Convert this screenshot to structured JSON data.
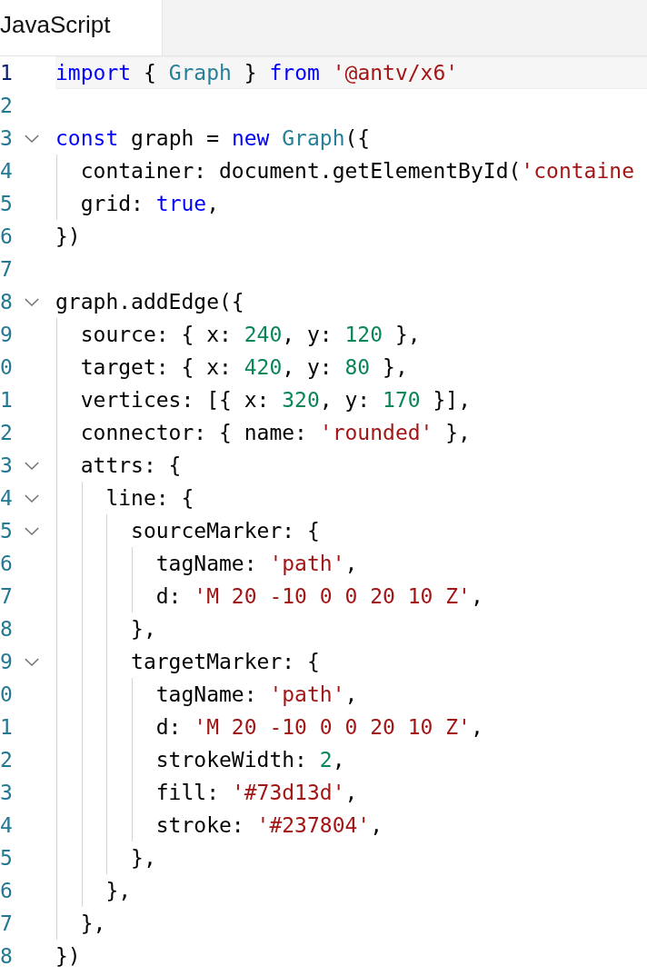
{
  "tabs": [
    {
      "label": "JavaScript",
      "selected": true
    }
  ],
  "lines": [
    {
      "number": "1",
      "current": true,
      "tokens": [
        {
          "kind": "keyword",
          "text": "import"
        },
        {
          "kind": "plain",
          "text": " { "
        },
        {
          "kind": "type",
          "text": "Graph"
        },
        {
          "kind": "plain",
          "text": " } "
        },
        {
          "kind": "keyword",
          "text": "from "
        },
        {
          "kind": "string",
          "text": "'@antv/x6'"
        }
      ]
    },
    {
      "number": "2",
      "current": false
    },
    {
      "number": "3",
      "current": false,
      "fold": {
        "expanded": true
      },
      "tokens": [
        {
          "kind": "keyword",
          "text": "const"
        },
        {
          "kind": "plain",
          "text": " graph = "
        },
        {
          "kind": "keyword",
          "text": "new "
        },
        {
          "kind": "type",
          "text": "Graph"
        },
        {
          "kind": "plain",
          "text": "({"
        }
      ]
    },
    {
      "number": "4",
      "current": false,
      "tokens": [
        {
          "kind": "plain",
          "text": "  container: document.getElementById("
        },
        {
          "kind": "string",
          "text": "'containe"
        }
      ]
    },
    {
      "number": "5",
      "current": false,
      "tokens": [
        {
          "kind": "plain",
          "text": "  grid: "
        },
        {
          "kind": "keyword",
          "text": "true"
        },
        {
          "kind": "plain",
          "text": ","
        }
      ]
    },
    {
      "number": "6",
      "current": false,
      "tokens": [
        {
          "kind": "plain",
          "text": "})"
        }
      ]
    },
    {
      "number": "7",
      "current": false
    },
    {
      "number": "8",
      "current": false,
      "fold": {
        "expanded": true
      },
      "tokens": [
        {
          "kind": "plain",
          "text": "graph.addEdge({"
        }
      ]
    },
    {
      "number": "9",
      "current": false,
      "tokens": [
        {
          "kind": "plain",
          "text": "  source: { x: "
        },
        {
          "kind": "number",
          "text": "240"
        },
        {
          "kind": "plain",
          "text": ", y: "
        },
        {
          "kind": "number",
          "text": "120"
        },
        {
          "kind": "plain",
          "text": " },"
        }
      ]
    },
    {
      "number": "0",
      "current": false,
      "tokens": [
        {
          "kind": "plain",
          "text": "  target: { x: "
        },
        {
          "kind": "number",
          "text": "420"
        },
        {
          "kind": "plain",
          "text": ", y: "
        },
        {
          "kind": "number",
          "text": "80"
        },
        {
          "kind": "plain",
          "text": " },"
        }
      ]
    },
    {
      "number": "1",
      "current": false,
      "tokens": [
        {
          "kind": "plain",
          "text": "  vertices: [{ x: "
        },
        {
          "kind": "number",
          "text": "320"
        },
        {
          "kind": "plain",
          "text": ", y: "
        },
        {
          "kind": "number",
          "text": "170"
        },
        {
          "kind": "plain",
          "text": " }],"
        }
      ]
    },
    {
      "number": "2",
      "current": false,
      "tokens": [
        {
          "kind": "plain",
          "text": "  connector: { name: "
        },
        {
          "kind": "string",
          "text": "'rounded'"
        },
        {
          "kind": "plain",
          "text": " },"
        }
      ]
    },
    {
      "number": "3",
      "current": false,
      "fold": {
        "expanded": true
      },
      "tokens": [
        {
          "kind": "plain",
          "text": "  attrs: {"
        }
      ]
    },
    {
      "number": "4",
      "current": false,
      "fold": {
        "expanded": true
      },
      "tokens": [
        {
          "kind": "plain",
          "text": "    line: {"
        }
      ]
    },
    {
      "number": "5",
      "current": false,
      "fold": {
        "expanded": true
      },
      "tokens": [
        {
          "kind": "plain",
          "text": "      sourceMarker: {"
        }
      ]
    },
    {
      "number": "6",
      "current": false,
      "tokens": [
        {
          "kind": "plain",
          "text": "        tagName: "
        },
        {
          "kind": "string",
          "text": "'path'"
        },
        {
          "kind": "plain",
          "text": ","
        }
      ]
    },
    {
      "number": "7",
      "current": false,
      "tokens": [
        {
          "kind": "plain",
          "text": "        d: "
        },
        {
          "kind": "string",
          "text": "'M 20 -10 0 0 20 10 Z'"
        },
        {
          "kind": "plain",
          "text": ","
        }
      ]
    },
    {
      "number": "8",
      "current": false,
      "tokens": [
        {
          "kind": "plain",
          "text": "      },"
        }
      ]
    },
    {
      "number": "9",
      "current": false,
      "fold": {
        "expanded": true
      },
      "tokens": [
        {
          "kind": "plain",
          "text": "      targetMarker: {"
        }
      ]
    },
    {
      "number": "0",
      "current": false,
      "tokens": [
        {
          "kind": "plain",
          "text": "        tagName: "
        },
        {
          "kind": "string",
          "text": "'path'"
        },
        {
          "kind": "plain",
          "text": ","
        }
      ]
    },
    {
      "number": "1",
      "current": false,
      "tokens": [
        {
          "kind": "plain",
          "text": "        d: "
        },
        {
          "kind": "string",
          "text": "'M 20 -10 0 0 20 10 Z'"
        },
        {
          "kind": "plain",
          "text": ","
        }
      ]
    },
    {
      "number": "2",
      "current": false,
      "tokens": [
        {
          "kind": "plain",
          "text": "        strokeWidth: "
        },
        {
          "kind": "number",
          "text": "2"
        },
        {
          "kind": "plain",
          "text": ","
        }
      ]
    },
    {
      "number": "3",
      "current": false,
      "tokens": [
        {
          "kind": "plain",
          "text": "        fill: "
        },
        {
          "kind": "string",
          "text": "'#73d13d'"
        },
        {
          "kind": "plain",
          "text": ","
        }
      ]
    },
    {
      "number": "4",
      "current": false,
      "tokens": [
        {
          "kind": "plain",
          "text": "        stroke: "
        },
        {
          "kind": "string",
          "text": "'#237804'"
        },
        {
          "kind": "plain",
          "text": ","
        }
      ]
    },
    {
      "number": "5",
      "current": false,
      "tokens": [
        {
          "kind": "plain",
          "text": "      },"
        }
      ]
    },
    {
      "number": "6",
      "current": false,
      "tokens": [
        {
          "kind": "plain",
          "text": "    },"
        }
      ]
    },
    {
      "number": "7",
      "current": false,
      "tokens": [
        {
          "kind": "plain",
          "text": "  },"
        }
      ]
    },
    {
      "number": "8",
      "current": false,
      "tokens": [
        {
          "kind": "plain",
          "text": "})"
        }
      ]
    }
  ]
}
